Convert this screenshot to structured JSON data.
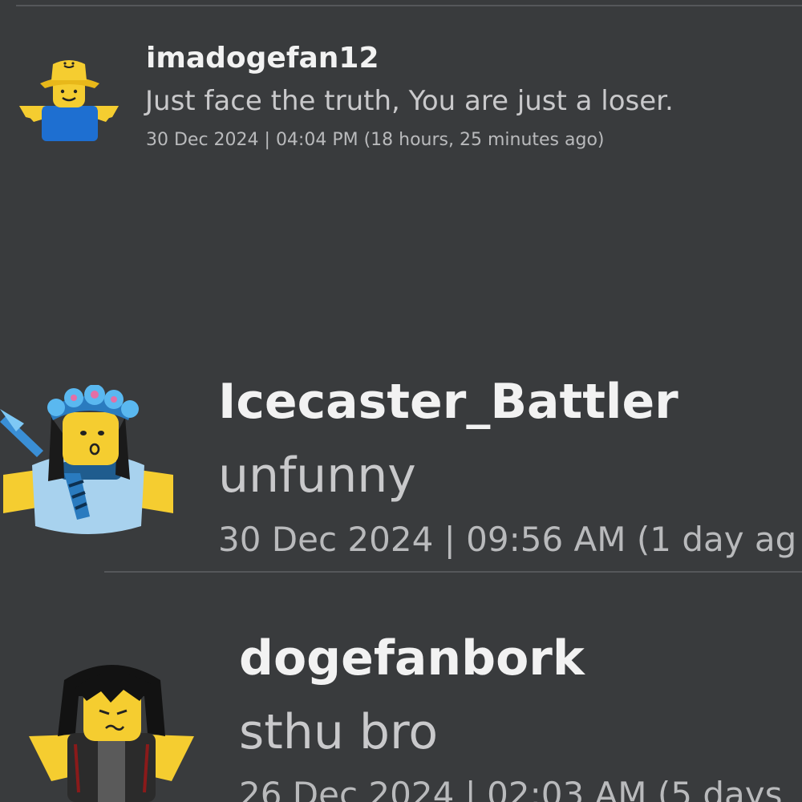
{
  "comments": [
    {
      "username": "imadogefan12",
      "text": "Just face the truth, You are just a loser.",
      "timestamp": "30 Dec 2024 | 04:04 PM (18 hours, 25 minutes ago)"
    },
    {
      "username": "Icecaster_Battler",
      "text": "unfunny",
      "timestamp": "30 Dec 2024 | 09:56 AM (1 day ag"
    },
    {
      "username": "dogefanbork",
      "text": "sthu bro",
      "timestamp": "26 Dec 2024 | 02:03 AM (5 days"
    }
  ],
  "colors": {
    "background": "#393b3d",
    "username": "#f2f2f2",
    "text": "#c9c9cb",
    "timestamp": "#b9babc",
    "avatar_yellow": "#f5cd30",
    "avatar_blue": "#1e6fd1"
  }
}
